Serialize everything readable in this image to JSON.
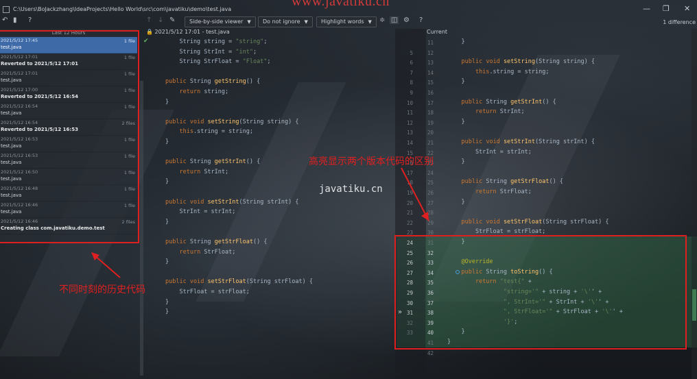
{
  "window": {
    "path": "C:\\Users\\BoJackzhang\\IdeaProjects\\Hello World\\src\\com\\javatiku\\demo\\test.java",
    "watermark_top": "www.javatiku.cn",
    "minimize": "—",
    "maximize": "❐",
    "close": "✕"
  },
  "toolbar": {
    "viewer": "Side-by-side viewer",
    "whitespace": "Do not ignore",
    "highlight": "Highlight words",
    "help": "?",
    "difference_count": "1 difference"
  },
  "history": {
    "header": "Last 12 Hours",
    "items": [
      {
        "date": "2021/5/12 17:45",
        "msg": "test.java",
        "count": "1 file",
        "bold": false,
        "selected": true
      },
      {
        "date": "2021/5/12 17:01",
        "msg": "Reverted to 2021/5/12 17:01",
        "count": "1 file",
        "bold": true,
        "selected": false
      },
      {
        "date": "2021/5/12 17:01",
        "msg": "test.java",
        "count": "1 file",
        "bold": false,
        "selected": false
      },
      {
        "date": "2021/5/12 17:00",
        "msg": "Reverted to 2021/5/12 16:54",
        "count": "1 file",
        "bold": true,
        "selected": false
      },
      {
        "date": "2021/5/12 16:54",
        "msg": "test.java",
        "count": "1 file",
        "bold": false,
        "selected": false
      },
      {
        "date": "2021/5/12 16:54",
        "msg": "Reverted to 2021/5/12 16:53",
        "count": "2 files",
        "bold": true,
        "selected": false
      },
      {
        "date": "2021/5/12 16:53",
        "msg": "test.java",
        "count": "1 file",
        "bold": false,
        "selected": false
      },
      {
        "date": "2021/5/12 16:53",
        "msg": "test.java",
        "count": "1 file",
        "bold": false,
        "selected": false
      },
      {
        "date": "2021/5/12 16:50",
        "msg": "test.java",
        "count": "1 file",
        "bold": false,
        "selected": false
      },
      {
        "date": "2021/5/12 16:48",
        "msg": "test.java",
        "count": "1 file",
        "bold": false,
        "selected": false
      },
      {
        "date": "2021/5/12 16:46",
        "msg": "test.java",
        "count": "1 file",
        "bold": false,
        "selected": false
      },
      {
        "date": "2021/5/12 16:46",
        "msg": "Creating class com.javatiku.demo.test",
        "count": "2 files",
        "bold": true,
        "selected": false
      }
    ]
  },
  "panels": {
    "left_title": "2021/5/12 17:01 - test.java",
    "right_title": "Current"
  },
  "left_code": [
    "    String string = \"string\";",
    "    String StrInt = \"int\";",
    "    String StrFloat = \"Float\";",
    "",
    "public String getString() {",
    "    return string;",
    "}",
    "",
    "public void setString(String string) {",
    "    this.string = string;",
    "}",
    "",
    "public String getStrInt() {",
    "    return StrInt;",
    "}",
    "",
    "public void setStrInt(String strInt) {",
    "    StrInt = strInt;",
    "}",
    "",
    "public String getStrFloat() {",
    "    return StrFloat;",
    "}",
    "",
    "public void setStrFloat(String strFloat) {",
    "    StrFloat = strFloat;",
    "}",
    "}"
  ],
  "left_line_numbers": [
    "",
    "5",
    "6",
    "7",
    "8",
    "9",
    "10",
    "11",
    "12",
    "13",
    "14",
    "15",
    "16",
    "17",
    "18",
    "19",
    "20",
    "21",
    "22",
    "23",
    "24",
    "25",
    "26",
    "27",
    "28",
    "29",
    "30",
    "31",
    "32",
    "33"
  ],
  "right_line_numbers": [
    "11",
    "12",
    "13",
    "14",
    "15",
    "16",
    "17",
    "18",
    "19",
    "20",
    "21",
    "22",
    "23",
    "24",
    "25",
    "26",
    "27",
    "28",
    "29",
    "30",
    "31",
    "32",
    "33",
    "34",
    "35",
    "36",
    "37",
    "38",
    "39",
    "40",
    "41",
    "42"
  ],
  "right_code": [
    "    }",
    "",
    "    public void setString(String string) {",
    "        this.string = string;",
    "    }",
    "",
    "    public String getStrInt() {",
    "        return StrInt;",
    "    }",
    "",
    "    public void setStrInt(String strInt) {",
    "        StrInt = strInt;",
    "    }",
    "",
    "    public String getStrFloat() {",
    "        return StrFloat;",
    "    }",
    "",
    "    public void setStrFloat(String strFloat) {",
    "        StrFloat = strFloat;",
    "    }",
    "",
    "    @Override",
    "    public String toString() {",
    "        return \"test{\" +",
    "                \"string='\" + string + '\\'' +",
    "                \", StrInt='\" + StrInt + '\\'' +",
    "                \", StrFloat='\" + StrFloat + '\\'' +",
    "                '}';",
    "    }",
    "}",
    ""
  ],
  "annotations": {
    "highlight_label": "高亮显示两个版本代码的区别",
    "history_label": "不同时刻的历史代码",
    "watermark_mid": "javatiku.cn"
  },
  "colors": {
    "accent_selected": "#3e6ba8",
    "annotation_red": "#e02020",
    "diff_green": "#346e4a"
  }
}
